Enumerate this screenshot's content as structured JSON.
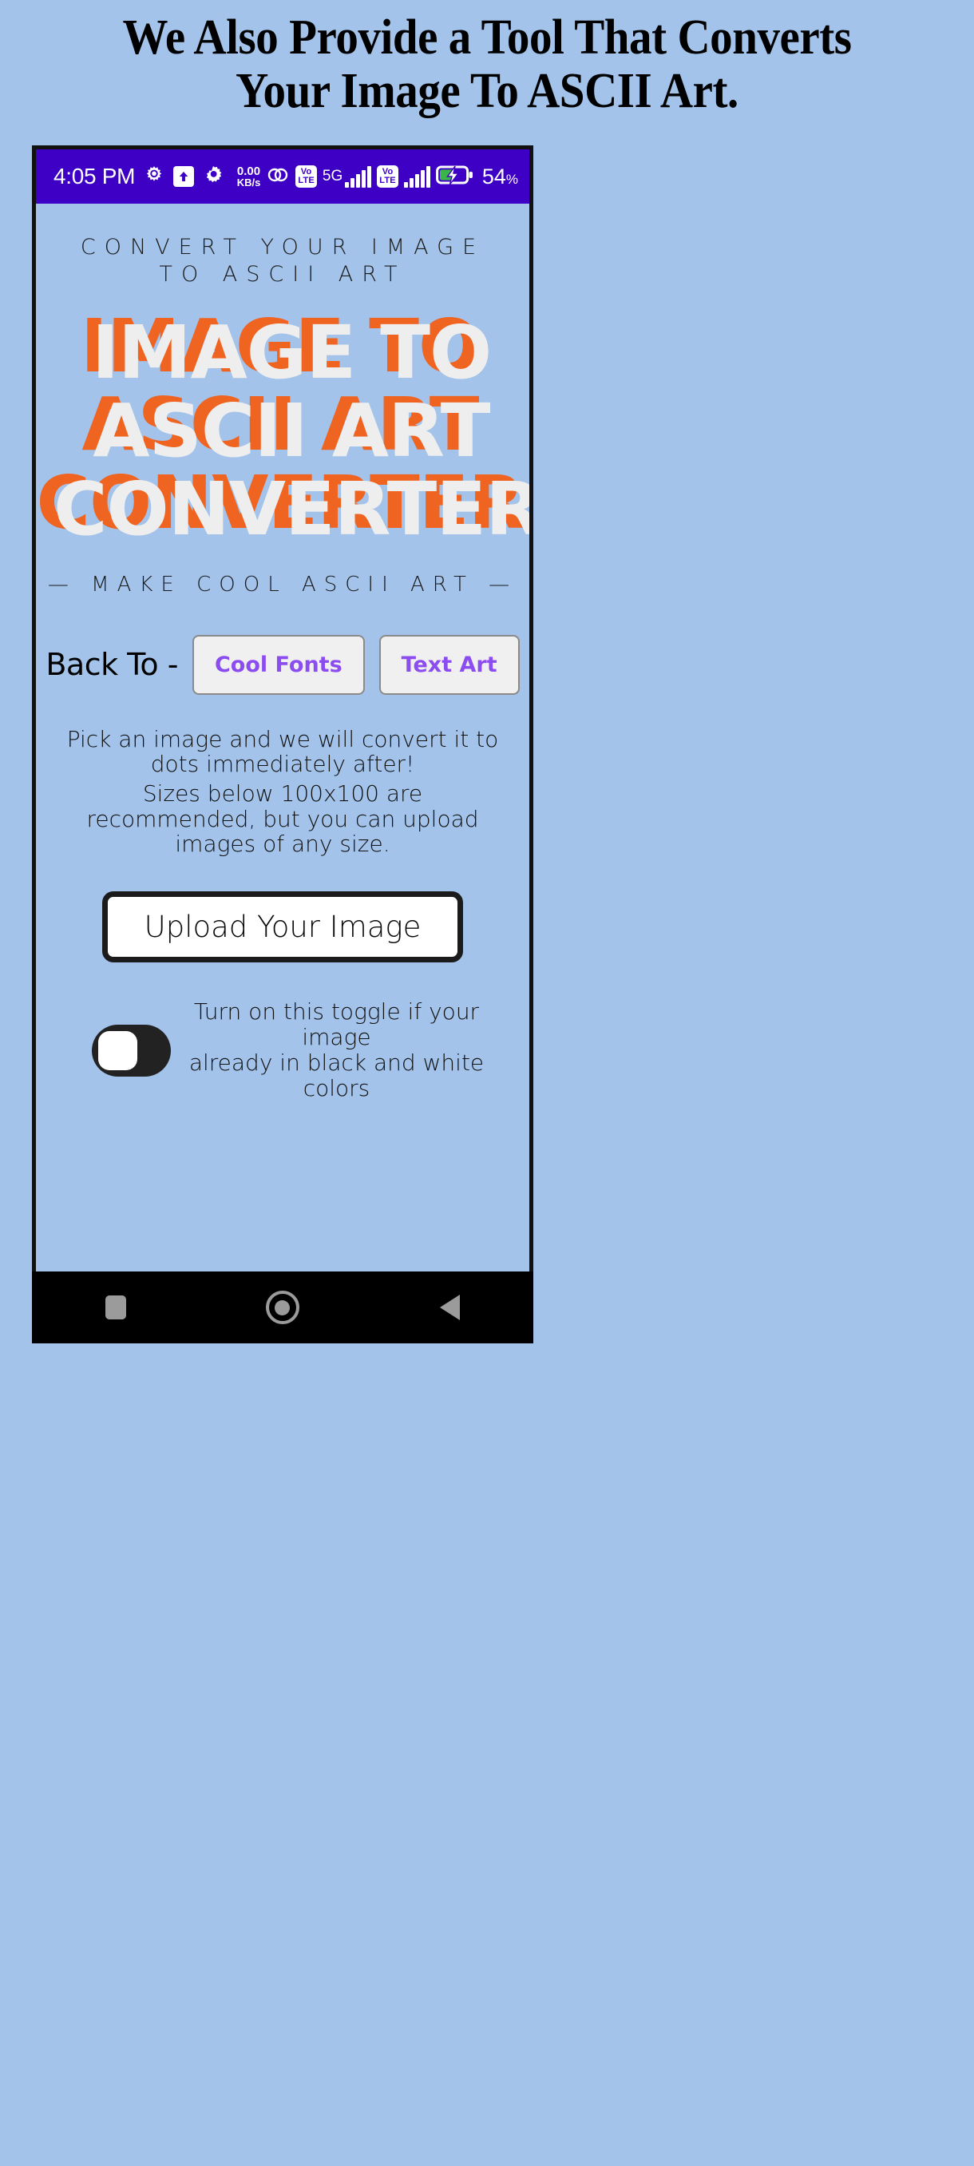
{
  "page": {
    "heading": "We Also Provide a Tool That Converts Your Image To ASCII Art."
  },
  "status_bar": {
    "time": "4:05 PM",
    "net_speed_value": "0.00",
    "net_speed_unit": "KB/s",
    "five_g_label": "5G",
    "volte_top": "Vo",
    "volte_bottom": "LTE",
    "battery_percent": "54",
    "battery_percent_symbol": "%",
    "background_color": "#3d00c4",
    "icons": [
      "alarm-icon",
      "upload-arrow-icon",
      "gear-icon",
      "dual-sim-icon",
      "volte-icon",
      "signal-bars-icon",
      "battery-charging-icon"
    ]
  },
  "app": {
    "eyebrow": "CONVERT YOUR IMAGE TO ASCII ART",
    "title": "IMAGE TO\nASCII ART\nCONVERTER",
    "title_color_back": "#ef6421",
    "title_color_front": "#eeeeee",
    "tagline": "—  MAKE COOL ASCII ART  —",
    "back_to_label": "Back To -",
    "back_to_buttons": [
      {
        "label": "Cool Fonts"
      },
      {
        "label": "Text Art"
      }
    ],
    "info_line_1": "Pick an image and we will convert it to dots immediately after!",
    "info_line_2": "Sizes below 100x100 are recommended, but you can upload images of any size.",
    "upload_button_label": "Upload Your Image",
    "toggle_state": "off",
    "toggle_description": "Turn on this toggle if your image\nalready in black and white colors",
    "accent_color": "#8b4cf0",
    "background_color": "#a3c3ea"
  },
  "nav_bar": {
    "buttons": [
      "recents-square-icon",
      "home-circle-icon",
      "back-triangle-icon"
    ]
  }
}
